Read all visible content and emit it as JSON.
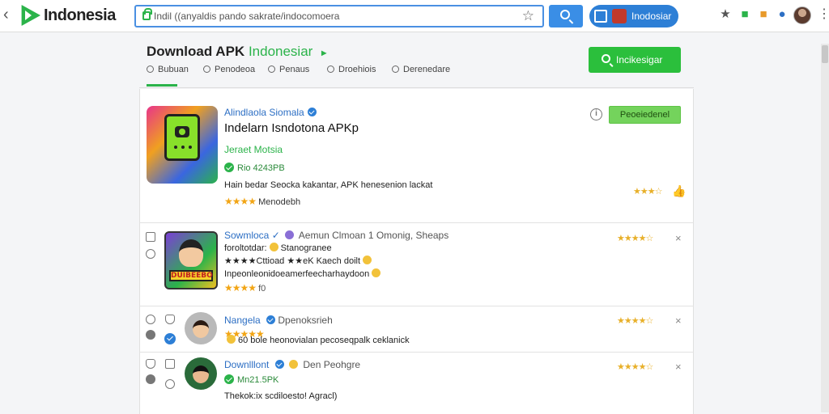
{
  "browser": {
    "back": "‹",
    "brand": "Indonesia",
    "url": "Indil ((anyaldis pando sakrate/indocomoera",
    "bookmark_icon": "star-outline-icon",
    "pill_label": "Inodosiar",
    "menu": "⋮"
  },
  "header": {
    "title_main": "Download APK",
    "title_accent": "Indonesiar",
    "title_chevron": "▸",
    "cta_label": "Incikesigar"
  },
  "tabs": [
    {
      "label": "Bubuan"
    },
    {
      "label": "Penodeoa"
    },
    {
      "label": "Penaus"
    },
    {
      "label": "Droehiois"
    },
    {
      "label": "Derenedare"
    }
  ],
  "featured": {
    "brand": "Alindlaola Siomala",
    "title": "Indelarn Isndotona APKp",
    "subtitle": "Jeraet Motsia",
    "size": "Rio 4243PB",
    "description": "Hain bedar Seocka kakantar, APK henesenion lackat",
    "rating_stars": "★★★★",
    "rating_label": "Menodebh",
    "button_label": "Peoeiedenel",
    "right_stars": "★★★☆",
    "info": "i"
  },
  "list": [
    {
      "title": "Sowmloca",
      "meta": "Aemun Clmoan 1 Omonig, Sheaps",
      "line2": "foroltotdar:",
      "line2b": "Stanogranee",
      "line3": "★★★★Cttioad ★★eK Kaech doilt",
      "line4": "Inpeonleonidoeamerfeecharhaydoon",
      "rating": "★★★★",
      "rating_count": "f0",
      "right_stars": "★★★★☆",
      "close": "×",
      "icon_text": "DUIBEEBO"
    },
    {
      "title": "Nangela",
      "meta": "Dpenoksrieh",
      "rating": "★★★★★",
      "line2": "60 bole heonovialan pecoseqpalk ceklanick",
      "right_stars": "★★★★☆",
      "close": "×"
    },
    {
      "title": "Downlllont",
      "meta": "Den Peohgre",
      "size": "Mn21.5PK",
      "line3": "Thekok:ix scdiloesto! Agracl)",
      "right_stars": "★★★★☆",
      "close": "×"
    }
  ]
}
